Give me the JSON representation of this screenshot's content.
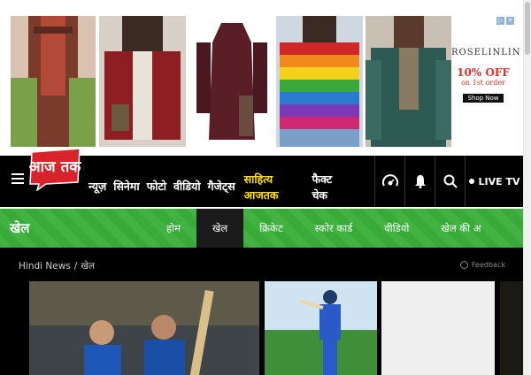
{
  "ad": {
    "brand": "ROSELINLIN",
    "offer": "10% OFF",
    "offer_note": "on 1st order",
    "shop_button": "Shop Now",
    "close_icons": [
      "adchoices-icon",
      "close-icon"
    ]
  },
  "header": {
    "logo_text": "आज तक",
    "nav": [
      {
        "label": "न्यूज़"
      },
      {
        "label": "सिनेमा"
      },
      {
        "label": "फोटो"
      },
      {
        "label": "वीडियो"
      },
      {
        "label": "गैजेट्स"
      }
    ],
    "nav_highlight": {
      "line1": "साहित्य",
      "line2": "आजतक"
    },
    "nav_last": {
      "line1": "फैक्ट",
      "line2": "चेक"
    },
    "live_tv": "LIVE TV",
    "icons": [
      "podcast-icon",
      "notification-bell-icon",
      "search-icon"
    ]
  },
  "section": {
    "title": "खेल",
    "tabs": [
      {
        "label": "होम"
      },
      {
        "label": "खेल",
        "active": true
      },
      {
        "label": "क्रिकेट"
      },
      {
        "label": "स्कोर कार्ड"
      },
      {
        "label": "वीडियो"
      },
      {
        "label": "खेल की अ"
      }
    ]
  },
  "breadcrumb": {
    "home": "Hindi News",
    "separator": "/",
    "current": "खेल"
  },
  "feedback": "Feedback",
  "colors": {
    "header_bg": "#000000",
    "highlight": "#ffe000",
    "section_green": "#3aaf3a",
    "logo_red": "#d8232a"
  }
}
